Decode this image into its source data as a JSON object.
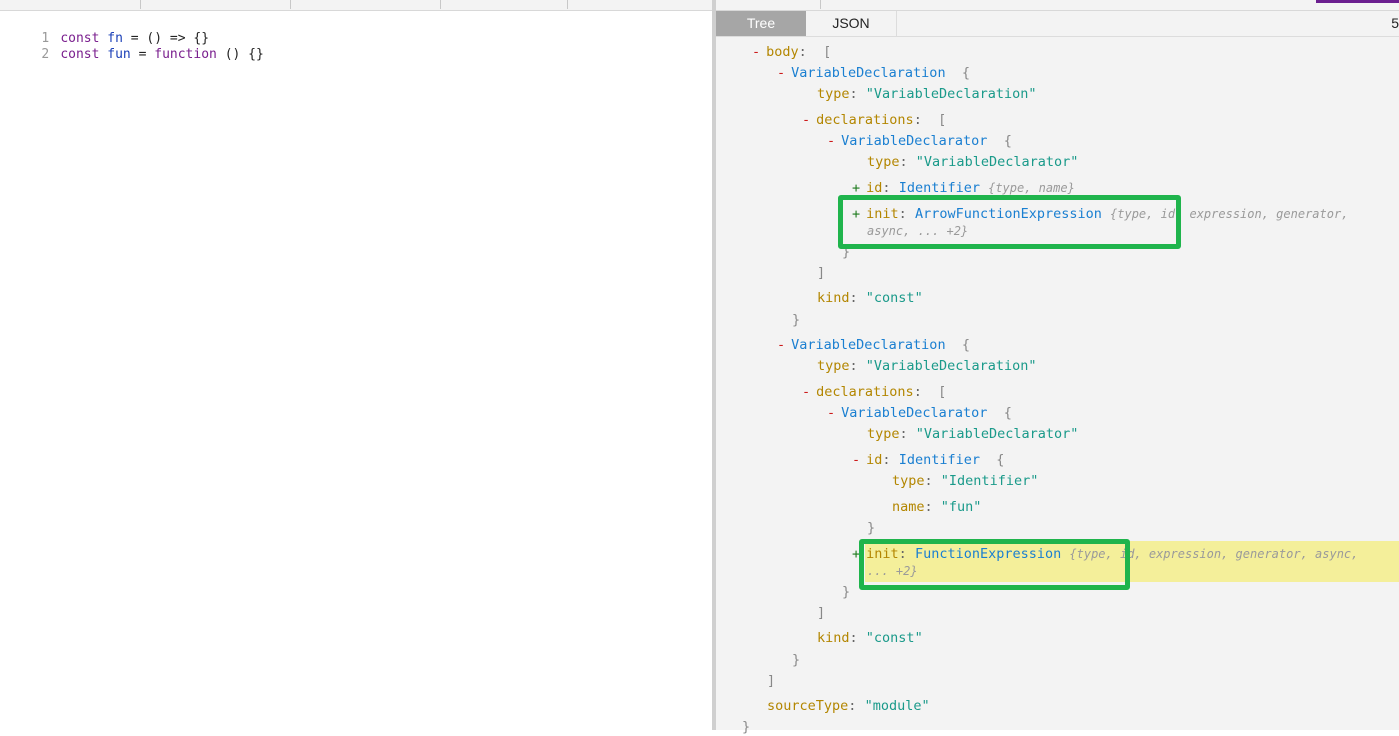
{
  "editor": {
    "lines": [
      {
        "num": "1",
        "kw": "const",
        "name": "fn",
        "rest": " = () => {}"
      },
      {
        "num": "2",
        "kw": "const",
        "name": "fun",
        "eq": " = ",
        "kw2": "function",
        "rest": " () {}"
      }
    ]
  },
  "tabs": {
    "tree": "Tree",
    "json": "JSON",
    "extra": "5"
  },
  "tree": {
    "body_key": "body",
    "open_bracket": "[",
    "close_bracket": "]",
    "open_brace": "{",
    "close_brace": "}",
    "colon": ":",
    "minus": "-",
    "plus": "+",
    "decl1": {
      "node": "VariableDeclaration",
      "type_key": "type",
      "type_val": "\"VariableDeclaration\"",
      "declarations_key": "declarations",
      "declarator": {
        "node": "VariableDeclarator",
        "type_key": "type",
        "type_val": "\"VariableDeclarator\"",
        "id_key": "id",
        "id_node": "Identifier",
        "id_meta": "{type, name}",
        "init_key": "init",
        "init_node": "ArrowFunctionExpression",
        "init_meta_1": "{type, id, expression, generator,",
        "init_meta_2": "async, ... +2}"
      },
      "kind_key": "kind",
      "kind_val": "\"const\""
    },
    "decl2": {
      "node": "VariableDeclaration",
      "type_key": "type",
      "type_val": "\"VariableDeclaration\"",
      "declarations_key": "declarations",
      "declarator": {
        "node": "VariableDeclarator",
        "type_key": "type",
        "type_val": "\"VariableDeclarator\"",
        "id_key": "id",
        "id_node": "Identifier",
        "id_type_key": "type",
        "id_type_val": "\"Identifier\"",
        "id_name_key": "name",
        "id_name_val": "\"fun\"",
        "init_key": "init",
        "init_node": "FunctionExpression",
        "init_meta_1": "{type, id, expression, generator, async,",
        "init_meta_2": "... +2}"
      },
      "kind_key": "kind",
      "kind_val": "\"const\""
    },
    "sourceType_key": "sourceType",
    "sourceType_val": "\"module\""
  },
  "colors": {
    "highlight_box": "#1fb44c",
    "hover_row": "#f4ef9a",
    "active_tab": "#a6a6a6"
  }
}
